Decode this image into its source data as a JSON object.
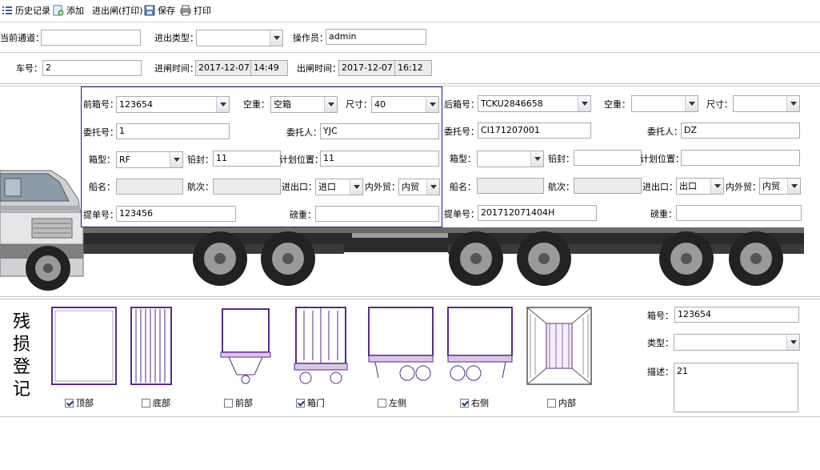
{
  "toolbar": {
    "history": "历史记录",
    "add": "添加",
    "gate_print": "进出闸(打印)",
    "save": "保存",
    "print": "打印"
  },
  "header": {
    "channel_label": "当前通道：",
    "channel_value": "",
    "io_type_label": "进出类型：",
    "io_type_value": "",
    "operator_label": "操作员：",
    "operator_value": "admin",
    "truck_no_label": "车号：",
    "truck_no_value": "2",
    "entry_time_label": "进闸时间：",
    "entry_date": "2017-12-07",
    "entry_time": "14:49",
    "exit_time_label": "出闸时间：",
    "exit_date": "2017-12-07",
    "exit_time": "16:12"
  },
  "front": {
    "box_no_label": "前箱号：",
    "box_no": "123654",
    "empty_label": "空重：",
    "empty_value": "空箱",
    "size_label": "尺寸：",
    "size_value": "40",
    "consignee_label": "委托号：",
    "consignee_value": "1",
    "client_label": "委托人：",
    "client_value": "YJC",
    "type_label": "箱型：",
    "type_value": "RF",
    "seal_label": "铅封：",
    "seal_value": "11",
    "plan_label": "计划位置：",
    "plan_value": "11",
    "ship_label": "船名：",
    "ship_value": "",
    "voyage_label": "航次：",
    "voyage_value": "",
    "io_port_label": "进出口：",
    "io_port_value": "进口",
    "trade_label": "内外贸：",
    "trade_value": "内贸",
    "bill_label": "提单号：",
    "bill_value": "123456",
    "weight_label": "磅重：",
    "weight_value": ""
  },
  "rear": {
    "box_no_label": "后箱号：",
    "box_no": "TCKU2846658",
    "empty_label": "空重：",
    "empty_value": "",
    "size_label": "尺寸：",
    "size_value": "",
    "consignee_label": "委托号：",
    "consignee_value": "CI171207001",
    "client_label": "委托人：",
    "client_value": "DZ",
    "type_label": "箱型：",
    "type_value": "",
    "seal_label": "铅封：",
    "seal_value": "",
    "plan_label": "计划位置：",
    "plan_value": "",
    "ship_label": "船名：",
    "ship_value": "",
    "voyage_label": "航次：",
    "voyage_value": "",
    "io_port_label": "进出口：",
    "io_port_value": "出口",
    "trade_label": "内外贸：",
    "trade_value": "内贸",
    "bill_label": "提单号：",
    "bill_value": "201712071404H",
    "weight_label": "磅重：",
    "weight_value": ""
  },
  "damage": {
    "title_chars": [
      "残",
      "损",
      "登",
      "记"
    ],
    "parts": [
      {
        "label": "顶部",
        "checked": true
      },
      {
        "label": "底部",
        "checked": false
      },
      {
        "label": "前部",
        "checked": false
      },
      {
        "label": "箱门",
        "checked": true
      },
      {
        "label": "左侧",
        "checked": false
      },
      {
        "label": "右侧",
        "checked": true
      },
      {
        "label": "内部",
        "checked": false
      }
    ],
    "box_no_label": "箱号：",
    "box_no_value": "123654",
    "type_label": "类型：",
    "type_value": "",
    "desc_label": "描述：",
    "desc_value": "21"
  },
  "colors": {
    "panel_border": "#1b1f8a",
    "container_line": "#5b2a8a"
  }
}
